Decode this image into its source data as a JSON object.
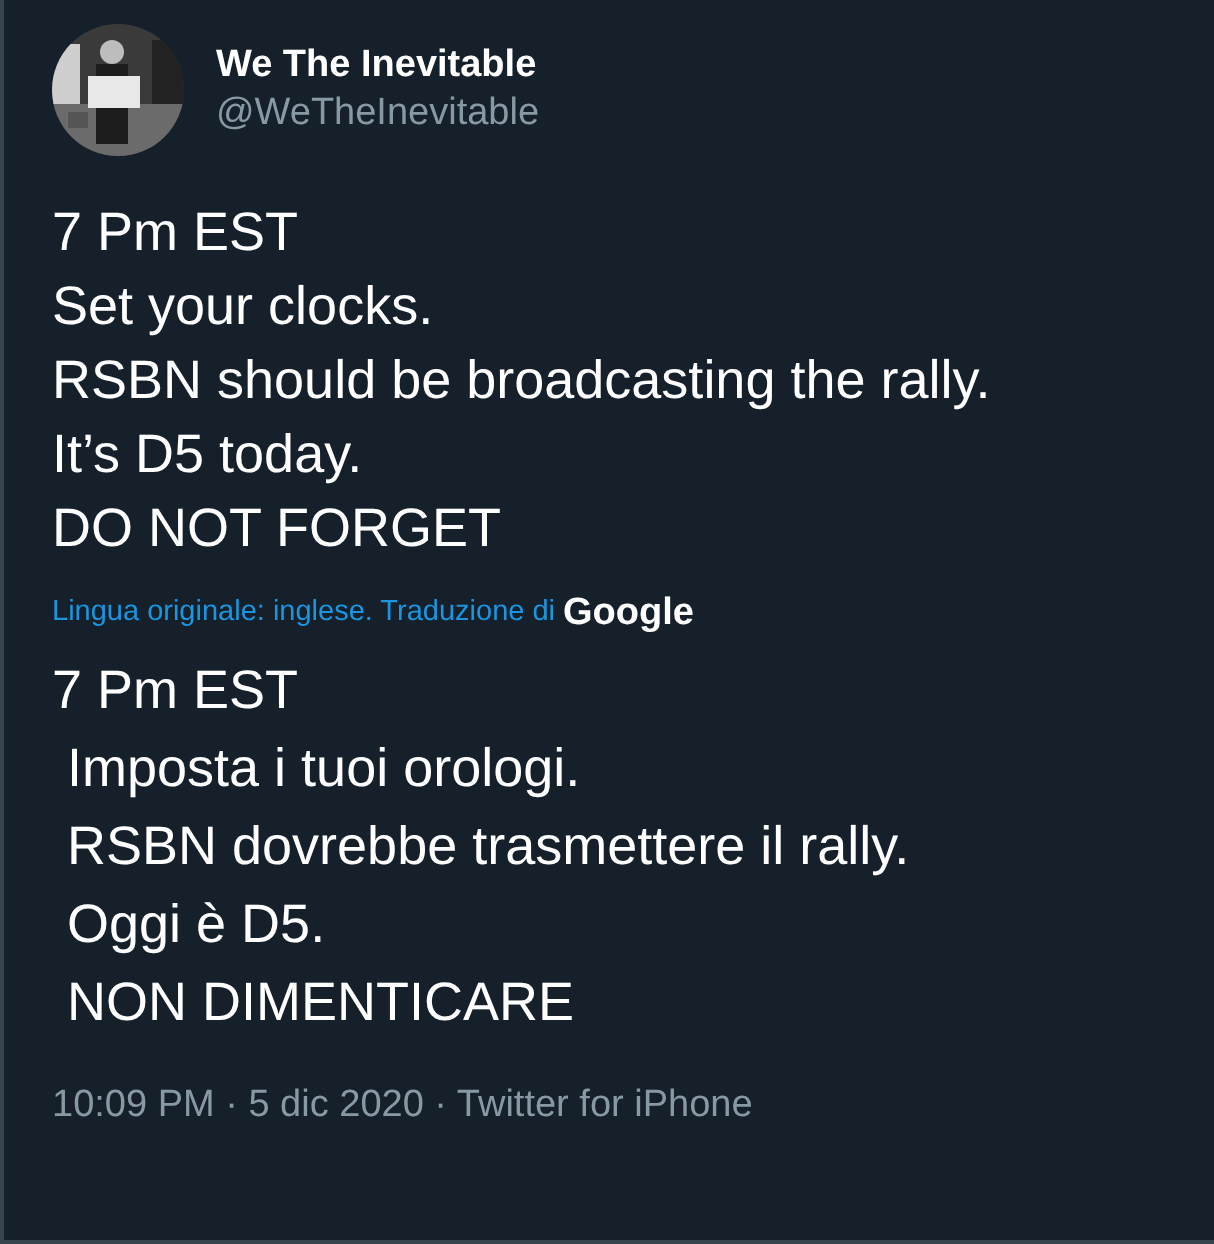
{
  "author": {
    "name": "We The Inevitable",
    "handle": "@WeTheInevitable"
  },
  "tweet_lines": [
    "7 Pm EST",
    "Set your clocks.",
    "RSBN should be broadcasting the rally.",
    "It’s D5 today.",
    "DO NOT FORGET"
  ],
  "translation_note": {
    "text": "Lingua originale: inglese. Traduzione di",
    "provider": "Google"
  },
  "translated_lines": [
    "7 Pm EST",
    " Imposta i tuoi orologi.",
    " RSBN dovrebbe trasmettere il rally.",
    " Oggi è D5.",
    " NON DIMENTICARE"
  ],
  "footer": "10:09 PM · 5 dic 2020 · Twitter for iPhone"
}
